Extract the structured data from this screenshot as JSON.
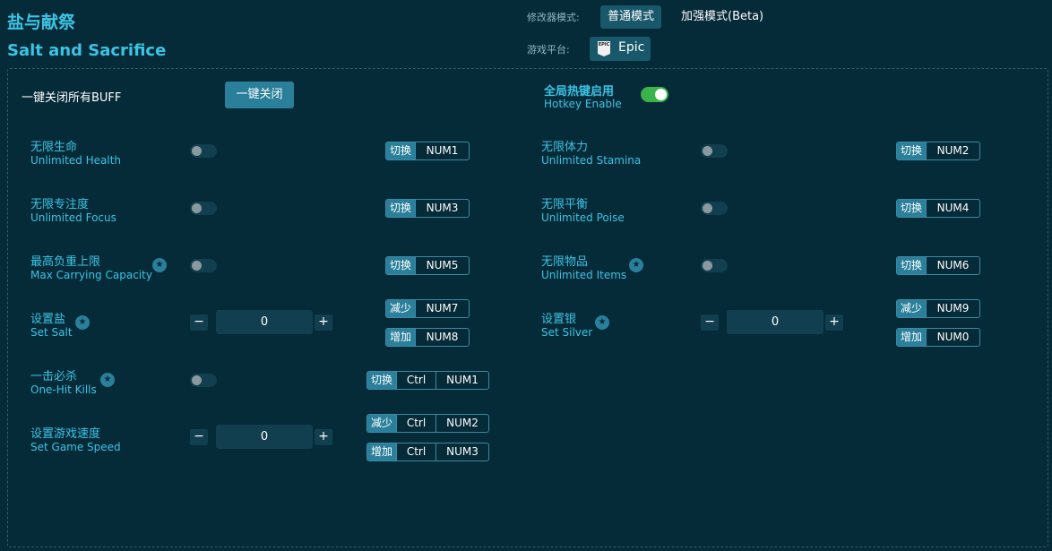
{
  "app": {
    "title_cn": "盐与献祭",
    "title_en": "Salt and Sacrifice"
  },
  "mode": {
    "label": "修改器模式:",
    "normal": "普通模式",
    "beta": "加强模式(Beta)"
  },
  "platform": {
    "label": "游戏平台:",
    "name": "Epic",
    "logo_text": "EPIC"
  },
  "buff": {
    "label": "一键关闭所有BUFF",
    "button": "一键关闭"
  },
  "hotkey_enable": {
    "cn": "全局热键启用",
    "en": "Hotkey Enable",
    "state": "on"
  },
  "star_glyph": "★",
  "features": {
    "f1": {
      "cn": "无限生命",
      "en": "Unlimited Health",
      "hk_action": "切换",
      "hk_key": "NUM1"
    },
    "f2": {
      "cn": "无限体力",
      "en": "Unlimited Stamina",
      "hk_action": "切换",
      "hk_key": "NUM2"
    },
    "f3": {
      "cn": "无限专注度",
      "en": "Unlimited Focus",
      "hk_action": "切换",
      "hk_key": "NUM3"
    },
    "f4": {
      "cn": "无限平衡",
      "en": "Unlimited Poise",
      "hk_action": "切换",
      "hk_key": "NUM4"
    },
    "f5": {
      "cn": "最高负重上限",
      "en": "Max Carrying Capacity",
      "hk_action": "切换",
      "hk_key": "NUM5"
    },
    "f6": {
      "cn": "无限物品",
      "en": "Unlimited Items",
      "hk_action": "切换",
      "hk_key": "NUM6"
    },
    "f7": {
      "cn": "设置盐",
      "en": "Set Salt",
      "value": "0",
      "dec_action": "减少",
      "dec_key": "NUM7",
      "inc_action": "增加",
      "inc_key": "NUM8"
    },
    "f8": {
      "cn": "设置银",
      "en": "Set Silver",
      "value": "0",
      "dec_action": "减少",
      "dec_key": "NUM9",
      "inc_action": "增加",
      "inc_key": "NUM0"
    },
    "f9": {
      "cn": "一击必杀",
      "en": "One-Hit Kills",
      "hk_action": "切换",
      "hk_mod": "Ctrl",
      "hk_key": "NUM1"
    },
    "f10": {
      "cn": "设置游戏速度",
      "en": "Set Game Speed",
      "value": "0",
      "dec_action": "减少",
      "dec_mod": "Ctrl",
      "dec_key": "NUM2",
      "inc_action": "增加",
      "inc_mod": "Ctrl",
      "inc_key": "NUM3"
    }
  },
  "stepper": {
    "minus": "−",
    "plus": "+"
  }
}
